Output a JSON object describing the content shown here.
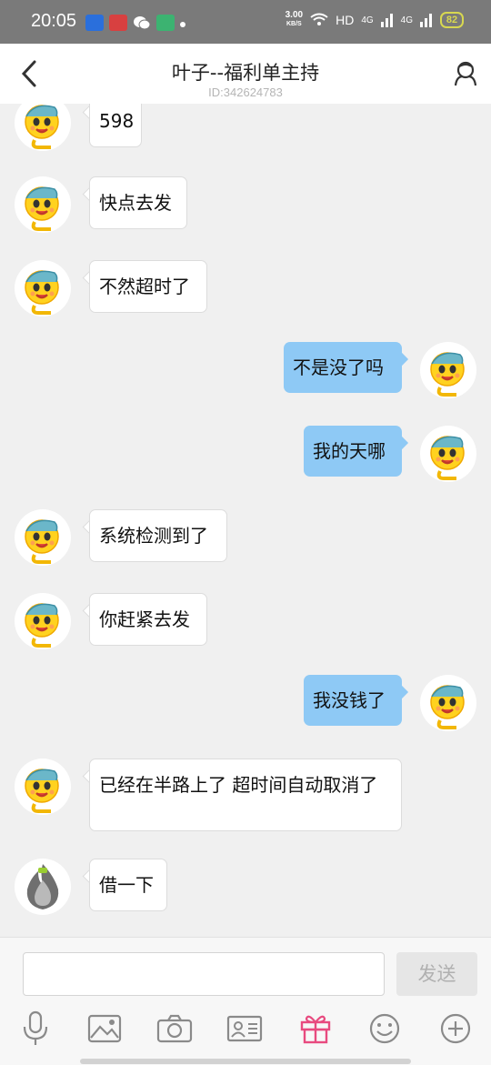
{
  "status": {
    "time": "20:05",
    "speed_value": "3.00",
    "speed_unit": "KB/S",
    "hd": "HD",
    "net1": "4G",
    "net2": "4G",
    "battery": "82"
  },
  "header": {
    "title": "叶子--福利单主持",
    "id_text": "ID:342624783"
  },
  "messages": [
    {
      "side": "in",
      "text": "598"
    },
    {
      "side": "in",
      "text": "快点去发"
    },
    {
      "side": "in",
      "text": "不然超时了"
    },
    {
      "side": "out",
      "text": "不是没了吗"
    },
    {
      "side": "out",
      "text": "我的天哪"
    },
    {
      "side": "in",
      "text": "系统检测到了"
    },
    {
      "side": "in",
      "text": "你赶紧去发"
    },
    {
      "side": "out",
      "text": "我没钱了"
    },
    {
      "side": "in",
      "text": "已经在半路上了 超时间自动取消了"
    },
    {
      "side": "in",
      "text": "借一下"
    }
  ],
  "input": {
    "placeholder": "",
    "send_label": "发送"
  },
  "toolbar": {
    "items": [
      "microphone-icon",
      "image-icon",
      "camera-icon",
      "contact-card-icon",
      "gift-icon",
      "emoji-icon",
      "plus-icon"
    ],
    "gift_color": "#e84a7f"
  },
  "colors": {
    "outgoing_bubble": "#8ec9f5",
    "incoming_bubble": "#ffffff",
    "background": "#f0f0f0"
  }
}
